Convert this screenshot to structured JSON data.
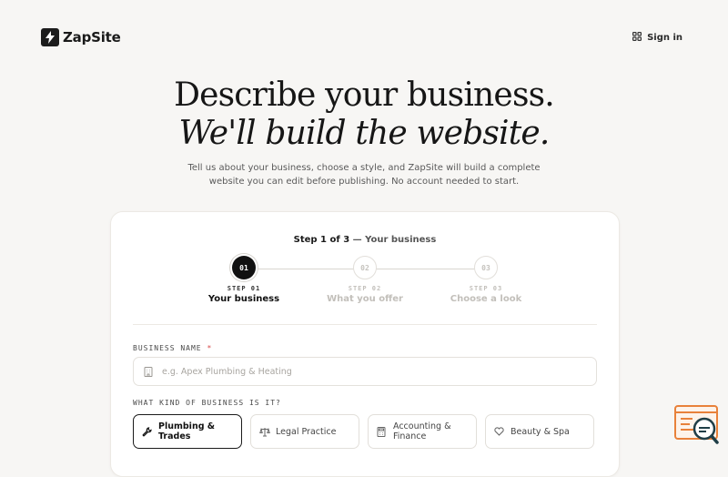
{
  "brand": {
    "name": "ZapSite"
  },
  "header": {
    "signin_label": "Sign in"
  },
  "hero": {
    "title_line1": "Describe your business.",
    "title_line2": "We'll build the website.",
    "subtitle_line1": "Tell us about your business, choose a style, and ZapSite will build a complete",
    "subtitle_line2": "website you can edit before publishing. No account needed to start."
  },
  "wizard": {
    "step_header": {
      "current": "Step 1 of 3",
      "separator": " — ",
      "name": "Your business"
    },
    "steps": [
      {
        "circle": "01",
        "number": "STEP 01",
        "label": "Your business",
        "state": "active"
      },
      {
        "circle": "02",
        "number": "STEP 02",
        "label": "What you offer",
        "state": "upcoming"
      },
      {
        "circle": "03",
        "number": "STEP 03",
        "label": "Choose a look",
        "state": "upcoming"
      }
    ],
    "business_name": {
      "label": "BUSINESS NAME",
      "required_mark": "*",
      "placeholder": "e.g. Apex Plumbing & Heating",
      "value": ""
    },
    "business_kind": {
      "label": "WHAT KIND OF BUSINESS IS IT?",
      "options": [
        {
          "line1": "Plumbing &",
          "line2": "Trades",
          "icon": "wrench-icon",
          "selected": true
        },
        {
          "line1": "Legal Practice",
          "line2": "",
          "icon": "scales-icon",
          "selected": false
        },
        {
          "line1": "Accounting &",
          "line2": "Finance",
          "icon": "calculator-icon",
          "selected": false
        },
        {
          "line1": "Beauty & Spa",
          "line2": "",
          "icon": "heart-icon",
          "selected": false
        }
      ]
    }
  },
  "colors": {
    "accent": "#111111",
    "background": "#f7f6f4",
    "required": "#d64545",
    "help_orange": "#e8813a"
  }
}
